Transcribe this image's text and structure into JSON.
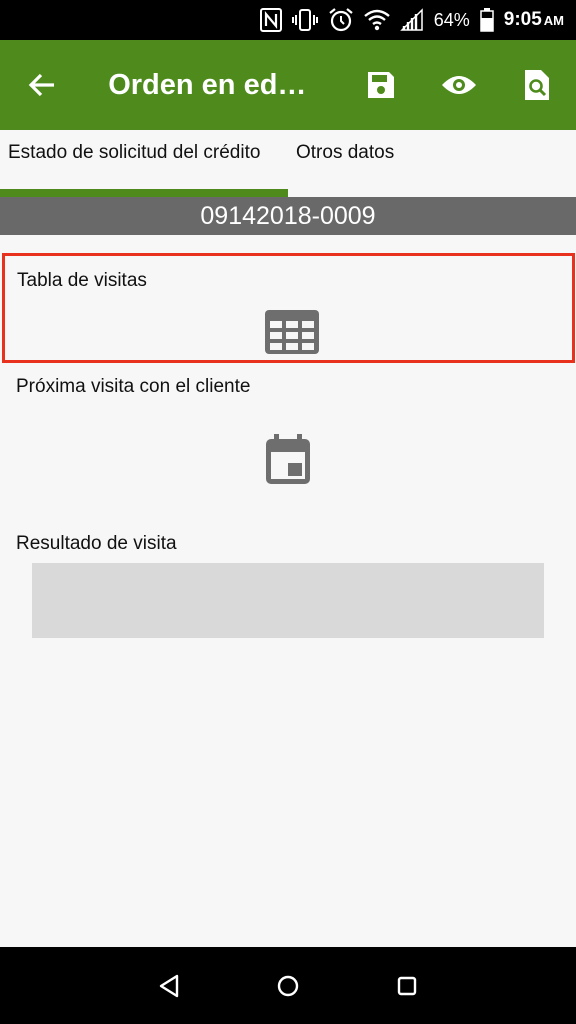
{
  "status_bar": {
    "battery": "64%",
    "time": "9:05",
    "ampm": "AM",
    "icons": [
      "nfc-icon",
      "vibrate-icon",
      "alarm-icon",
      "wifi-icon",
      "signal-icon",
      "battery-icon"
    ]
  },
  "app_bar": {
    "title": "Orden en edi…",
    "icons": [
      "back-arrow-icon",
      "save-icon",
      "eye-icon",
      "document-search-icon"
    ],
    "color": "#4e8b1c"
  },
  "tabs": [
    {
      "label": "Estado de solicitud del crédito",
      "active": true
    },
    {
      "label": "Otros datos",
      "active": false
    }
  ],
  "order_number": "09142018-0009",
  "sections": {
    "visits_table": {
      "label": "Tabla de visitas",
      "icon": "table-grid-icon",
      "highlight_color": "#e8321d"
    },
    "next_visit": {
      "label": "Próxima visita con el cliente",
      "icon": "calendar-icon"
    },
    "visit_result": {
      "label": "Resultado de visita",
      "value": ""
    }
  },
  "nav_bar": {
    "icons": [
      "nav-back-icon",
      "nav-home-icon",
      "nav-recents-icon"
    ]
  }
}
